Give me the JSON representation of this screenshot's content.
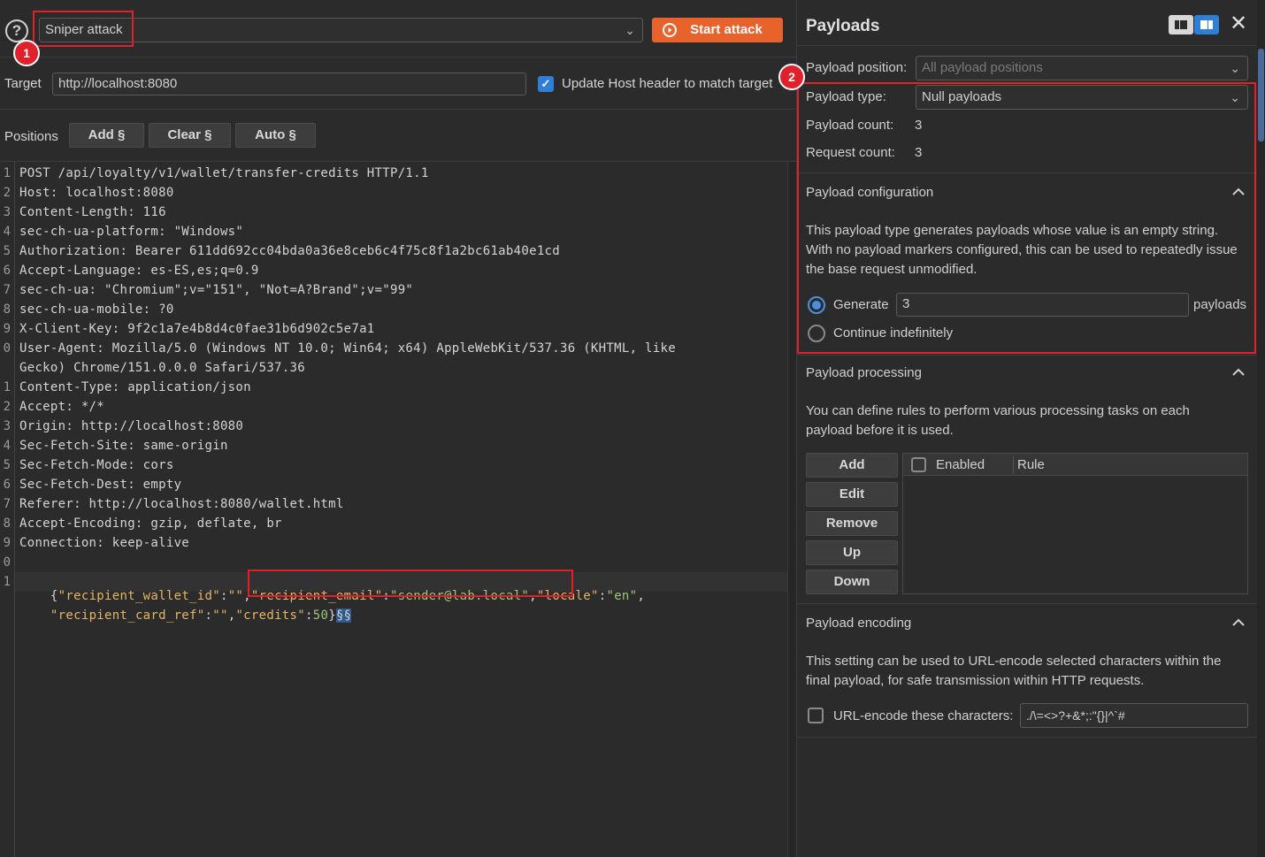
{
  "toolbar": {
    "attack_type": "Sniper attack",
    "start_attack": "Start attack",
    "help": "?"
  },
  "target": {
    "label": "Target",
    "url": "http://localhost:8080",
    "update_host_label": "Update Host header to match target",
    "update_host_checked": true
  },
  "positions": {
    "label": "Positions",
    "add": "Add §",
    "clear": "Clear §",
    "auto": "Auto §"
  },
  "request": {
    "line_numbers": [
      "1",
      "2",
      "3",
      "4",
      "5",
      "6",
      "7",
      "8",
      "9",
      "0",
      "",
      "1",
      "2",
      "3",
      "4",
      "5",
      "6",
      "7",
      "8",
      "9",
      "0",
      "1",
      ""
    ],
    "lines": [
      "POST /api/loyalty/v1/wallet/transfer-credits HTTP/1.1",
      "Host: localhost:8080",
      "Content-Length: 116",
      "sec-ch-ua-platform: \"Windows\"",
      "Authorization: Bearer 611dd692cc04bda0a36e8ceb6c4f75c8f1a2bc61ab40e1cd",
      "Accept-Language: es-ES,es;q=0.9",
      "sec-ch-ua: \"Chromium\";v=\"151\", \"Not=A?Brand\";v=\"99\"",
      "sec-ch-ua-mobile: ?0",
      "X-Client-Key: 9f2c1a7e4b8d4c0fae31b6d902c5e7a1",
      "User-Agent: Mozilla/5.0 (Windows NT 10.0; Win64; x64) AppleWebKit/537.36 (KHTML, like",
      "Gecko) Chrome/151.0.0.0 Safari/537.36",
      "Content-Type: application/json",
      "Accept: */*",
      "Origin: http://localhost:8080",
      "Sec-Fetch-Site: same-origin",
      "Sec-Fetch-Mode: cors",
      "Sec-Fetch-Dest: empty",
      "Referer: http://localhost:8080/wallet.html",
      "Accept-Encoding: gzip, deflate, br",
      "Connection: keep-alive",
      ""
    ],
    "body": {
      "open": "{",
      "k1": "\"recipient_wallet_id\"",
      "v1": "\"\"",
      "k2": "\"recipient_email\"",
      "v2": "\"sender@lab.local\"",
      "k3": "\"locale\"",
      "v3": "\"en\"",
      "k4": "\"recipient_card_ref\"",
      "v4": "\"\"",
      "k5": "\"credits\"",
      "v5": "50",
      "close": "}",
      "marker": "§§"
    }
  },
  "annotations": {
    "badge1": "1",
    "badge2": "2"
  },
  "payloads": {
    "title": "Payloads",
    "position_label": "Payload position:",
    "position_value": "All payload positions",
    "type_label": "Payload type:",
    "type_value": "Null payloads",
    "count_label": "Payload count:",
    "count_value": "3",
    "request_label": "Request count:",
    "request_value": "3"
  },
  "configuration": {
    "title": "Payload configuration",
    "description": "This payload type generates payloads whose value is an empty string. With no payload markers configured, this can be used to repeatedly issue the base request unmodified.",
    "generate_label": "Generate",
    "generate_value": "3",
    "payloads_suffix": "payloads",
    "continue_label": "Continue indefinitely"
  },
  "processing": {
    "title": "Payload processing",
    "description": "You can define rules to perform various processing tasks on each payload before it is used.",
    "add": "Add",
    "edit": "Edit",
    "remove": "Remove",
    "up": "Up",
    "down": "Down",
    "col_enabled": "Enabled",
    "col_rule": "Rule"
  },
  "encoding": {
    "title": "Payload encoding",
    "description": "This setting can be used to URL-encode selected characters within the final payload, for safe transmission within HTTP requests.",
    "urlencode_label": "URL-encode these characters:",
    "urlencode_value": "./\\=<>?+&*;:\"{}|^`#"
  },
  "colors": {
    "accent_orange": "#e8632b",
    "annotation_red": "#e0202a",
    "checkbox_blue": "#2f7fd9"
  }
}
